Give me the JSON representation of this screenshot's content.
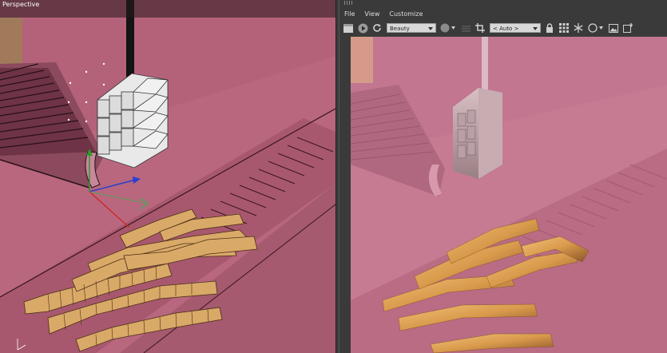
{
  "viewport": {
    "label": "Perspective"
  },
  "render_panel": {
    "menu": [
      "File",
      "View",
      "Customize"
    ],
    "render_mode": "Beauty",
    "camera_select": "< Auto >",
    "toolbar_icons": [
      "clapperboard-icon",
      "play-icon",
      "refresh-icon",
      "rgb-channel-icon",
      "crop-icon",
      "lock-icon",
      "grid-icon",
      "snowflake-icon",
      "circle-icon",
      "image-icon",
      "add-image-icon"
    ]
  },
  "colors": {
    "viewport_bg": "#b8677e",
    "render_bg": "#c67b92",
    "panel_bg": "#3a3a3a",
    "fry_viewport": "#d9a968",
    "fry_render": "#e3a95c"
  }
}
